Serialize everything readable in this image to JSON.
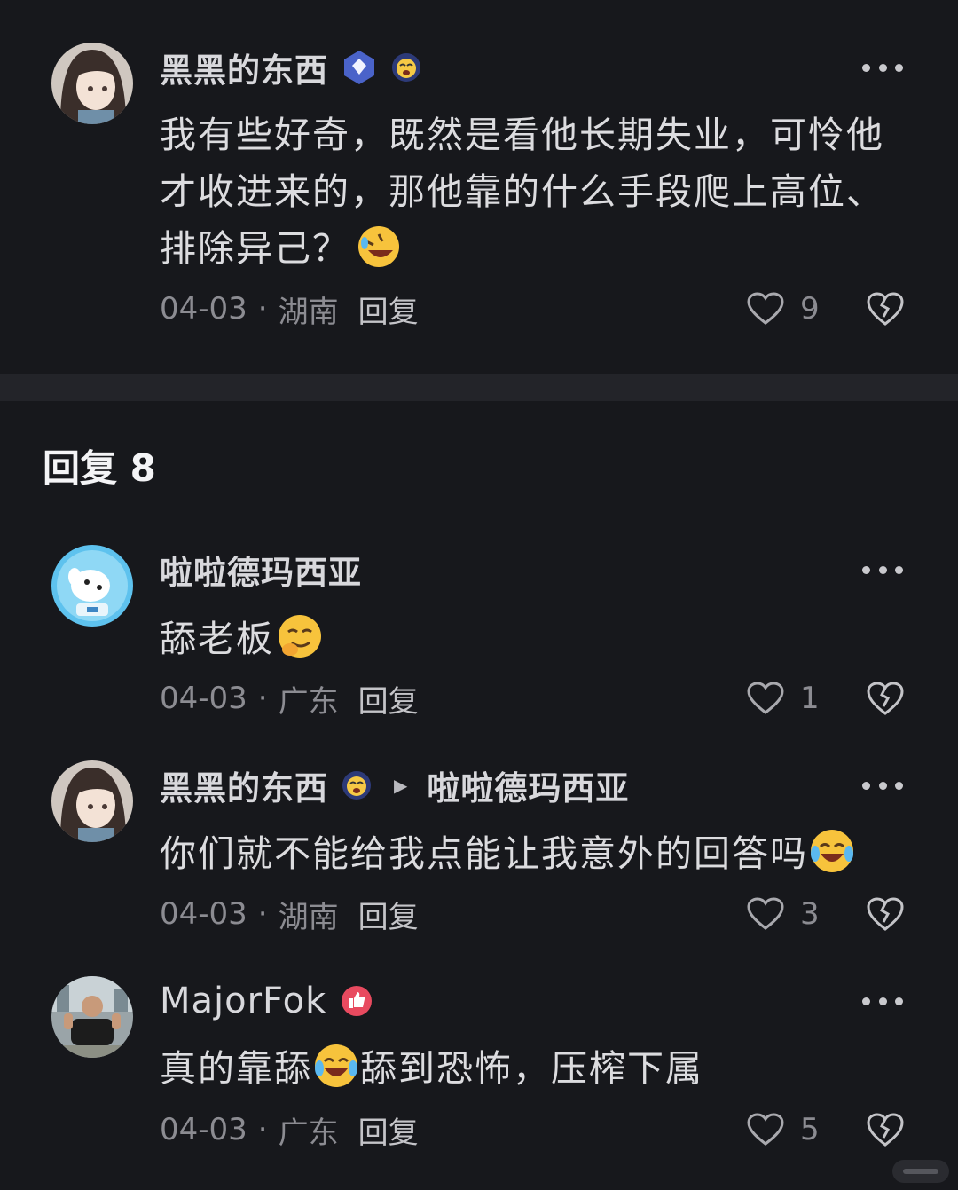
{
  "top_comment": {
    "author": "黑黑的东西",
    "text": "我有些好奇，既然是看他长期失业，可怜他才收进来的，那他靠的什么手段爬上高位、排除异己？",
    "date": "04-03",
    "location": "湖南",
    "reply_label": "回复",
    "likes": "9"
  },
  "replies_header": "回复 8",
  "replies": [
    {
      "author": "啦啦德玛西亚",
      "text": "舔老板",
      "date": "04-03",
      "location": "广东",
      "reply_label": "回复",
      "likes": "1"
    },
    {
      "author": "黑黑的东西",
      "reply_to": "啦啦德玛西亚",
      "text": "你们就不能给我点能让我意外的回答吗",
      "date": "04-03",
      "location": "湖南",
      "reply_label": "回复",
      "likes": "3"
    },
    {
      "author": "MajorFok",
      "text_before": "真的靠舔",
      "text_after": "舔到恐怖，压榨下属",
      "date": "04-03",
      "location": "广东",
      "reply_label": "回复",
      "likes": "5"
    }
  ],
  "separator": "·",
  "colors": {
    "background": "#17181c",
    "divider": "#232429",
    "text": "#dcdcdf",
    "meta": "#8c8c92"
  },
  "icons": [
    "more-icon",
    "heart-icon",
    "broken-heart-icon",
    "verified-diamond-icon",
    "crying-face-badge-icon",
    "thumbs-up-badge-icon",
    "rofl-emoji",
    "shushing-emoji",
    "laughing-crying-emoji"
  ]
}
